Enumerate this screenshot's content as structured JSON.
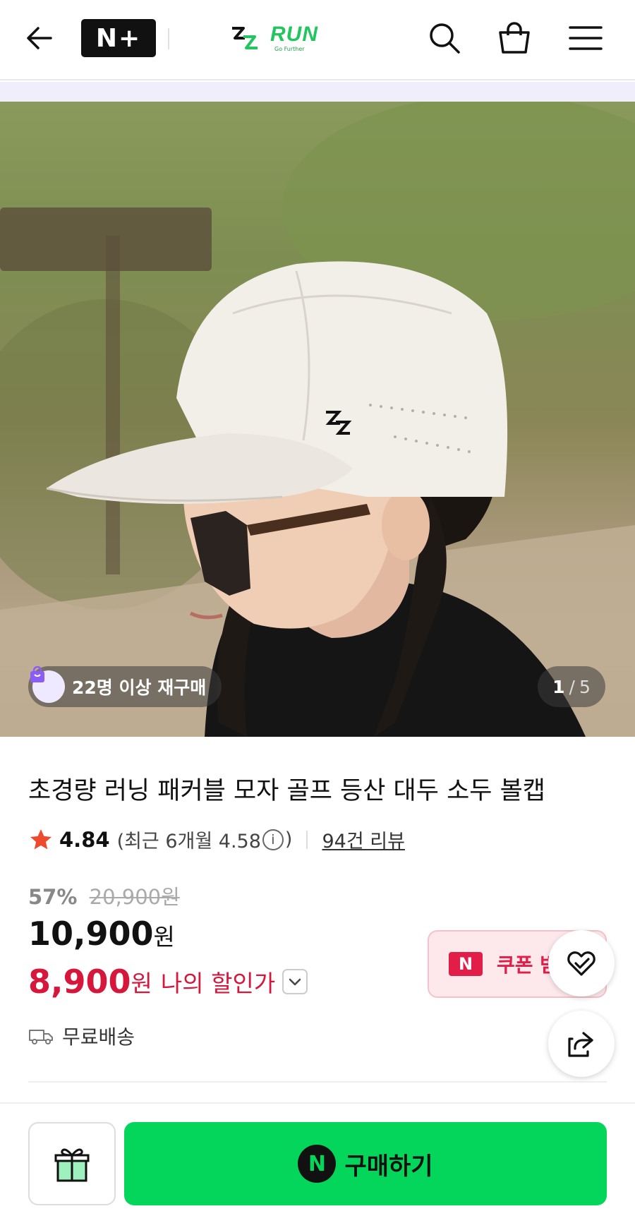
{
  "header": {
    "back_icon": "arrow-left-icon",
    "nplus_label": "N+",
    "brand_name": "RUN",
    "brand_tagline": "Go Further",
    "search_icon": "search-icon",
    "cart_icon": "shopping-bag-icon",
    "menu_icon": "hamburger-menu-icon"
  },
  "hero": {
    "repurchase_badge": "22명 이상 재구매",
    "counter_current": "1",
    "counter_separator": "/",
    "counter_total": "5"
  },
  "product": {
    "title": "초경량 러닝 패커블 모자 골프 등산 대두 소두 볼캡",
    "rating": "4.84",
    "recent_rating_prefix": "(최근 6개월 4.58",
    "recent_rating_suffix": ")",
    "review_count": "94건 리뷰",
    "discount_rate": "57%",
    "original_price": "20,900원",
    "price": "10,900",
    "price_unit": "원",
    "my_price": "8,900",
    "my_price_unit": "원",
    "my_price_label": "나의 할인가",
    "coupon_badge": "N",
    "coupon_text": "쿠폰 받",
    "shipping": "무료배송"
  },
  "bottom_bar": {
    "buy_badge": "N",
    "buy_label": "구매하기"
  },
  "colors": {
    "accent_green": "#03d65b",
    "discount_red": "#d6163b",
    "coupon_red": "#e11d48"
  }
}
